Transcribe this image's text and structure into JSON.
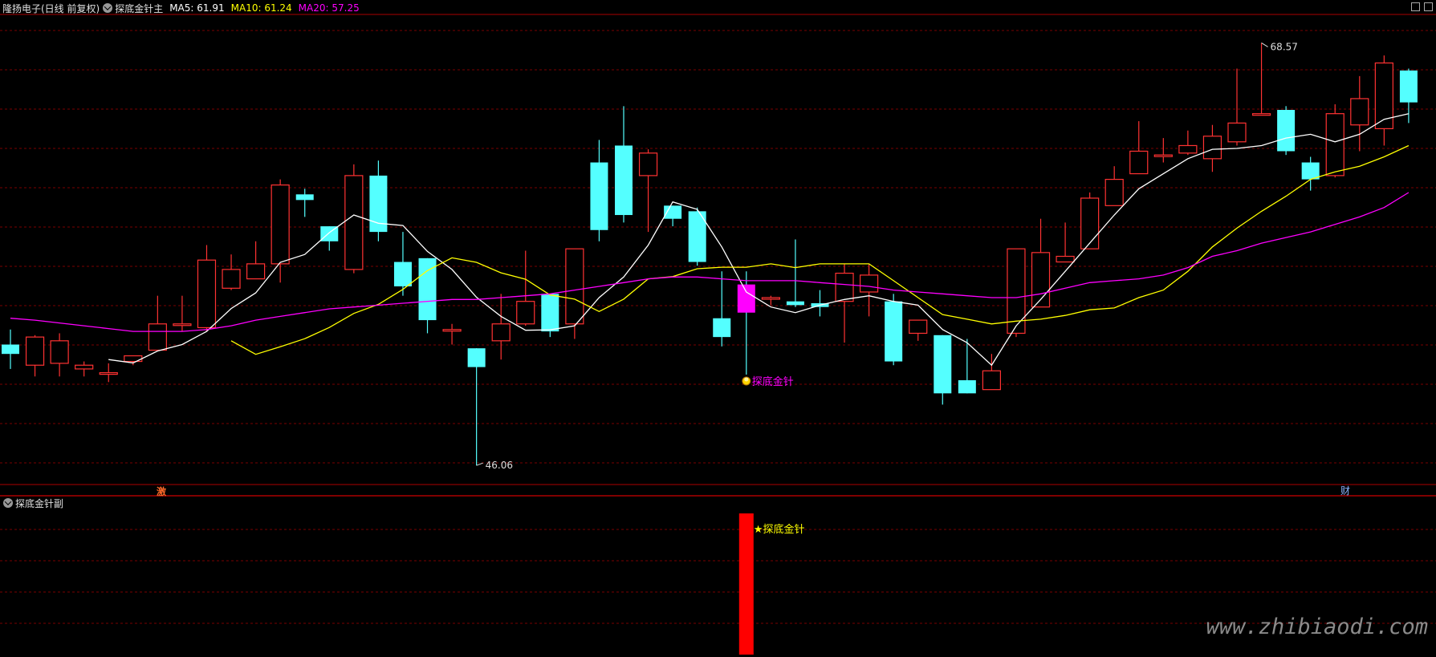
{
  "header": {
    "stock_name": "隆扬电子(日线 前复权)",
    "indicator_name": "探底金针主",
    "ma5_label": "MA5: 61.91",
    "ma10_label": "MA10: 61.24",
    "ma20_label": "MA20: 57.25"
  },
  "sub_panel": {
    "title": "探底金针副",
    "signal_label": "★探底金针"
  },
  "watermark": "www.zhibiaodi.com",
  "colors": {
    "up": "#ff3232",
    "down": "#54ffff",
    "ma5": "#ffffff",
    "ma10": "#ffff00",
    "ma20": "#ff00ff",
    "grid": "#7a0000",
    "signal": "#ff00ff",
    "bar": "#ff0000"
  },
  "icons": {
    "collapse": "chevron-circle-icon",
    "signal": "gold-coin-icon"
  },
  "chart_data": [
    {
      "type": "candlestick",
      "title": "探底金针主",
      "ylim": [
        45,
        70
      ],
      "grid": true,
      "annotations": {
        "high": "68.57",
        "low": "46.06",
        "signal": "探底金针",
        "markers": [
          "激",
          "财"
        ]
      },
      "candles": [
        [
          52.5,
          52.0,
          51.2,
          53.3
        ],
        [
          51.4,
          52.9,
          50.8,
          53.0
        ],
        [
          51.5,
          52.7,
          50.8,
          53.1
        ],
        [
          51.2,
          51.4,
          50.8,
          51.6
        ],
        [
          51.0,
          51.0,
          50.5,
          51.5
        ],
        [
          51.6,
          51.9,
          51.4,
          51.9
        ],
        [
          52.2,
          53.6,
          52.2,
          55.1
        ],
        [
          53.6,
          53.6,
          53.2,
          55.1
        ],
        [
          53.4,
          57.0,
          53.2,
          57.8
        ],
        [
          55.5,
          56.5,
          55.4,
          57.3
        ],
        [
          56.0,
          56.8,
          56.0,
          58.0
        ],
        [
          56.8,
          61.0,
          55.8,
          61.3
        ],
        [
          60.5,
          60.2,
          59.3,
          60.8
        ],
        [
          58.8,
          58.0,
          57.5,
          58.8
        ],
        [
          56.5,
          61.5,
          56.3,
          62.1
        ],
        [
          61.5,
          58.5,
          58.0,
          62.3
        ],
        [
          56.9,
          55.6,
          55.1,
          58.5
        ],
        [
          57.1,
          53.8,
          53.1,
          57.1
        ],
        [
          53.3,
          53.3,
          52.5,
          53.6
        ],
        [
          52.3,
          51.3,
          46.06,
          52.3
        ],
        [
          52.7,
          53.6,
          51.7,
          55.2
        ],
        [
          53.6,
          54.8,
          53.5,
          57.5
        ],
        [
          55.2,
          53.2,
          52.9,
          55.2
        ],
        [
          53.6,
          57.6,
          52.8,
          57.6
        ],
        [
          62.2,
          58.6,
          58.0,
          63.4
        ],
        [
          63.1,
          59.4,
          59.0,
          65.2
        ],
        [
          61.5,
          62.7,
          58.5,
          62.9
        ],
        [
          59.9,
          59.2,
          58.8,
          59.9
        ],
        [
          59.6,
          56.9,
          56.7,
          59.8
        ],
        [
          53.9,
          52.9,
          52.4,
          56.4
        ],
        [
          55.7,
          54.2,
          50.9,
          56.4
        ],
        [
          55.0,
          55.0,
          54.6,
          55.1
        ],
        [
          54.8,
          54.6,
          54.5,
          58.1
        ],
        [
          54.7,
          54.5,
          54.0,
          55.4
        ],
        [
          54.8,
          56.3,
          52.6,
          56.8
        ],
        [
          55.3,
          56.2,
          54.0,
          56.8
        ],
        [
          54.8,
          51.6,
          51.4,
          55.2
        ],
        [
          53.1,
          53.8,
          52.7,
          53.8
        ],
        [
          53.0,
          49.9,
          49.3,
          53.0
        ],
        [
          50.6,
          49.9,
          49.9,
          52.8
        ],
        [
          50.1,
          51.1,
          50.1,
          52.0
        ],
        [
          53.1,
          57.6,
          52.9,
          57.6
        ],
        [
          54.5,
          57.4,
          54.5,
          59.2
        ],
        [
          56.9,
          57.2,
          56.9,
          59.0
        ],
        [
          57.6,
          60.3,
          57.6,
          60.6
        ],
        [
          59.9,
          61.3,
          59.9,
          62.0
        ],
        [
          61.6,
          62.8,
          61.6,
          64.4
        ],
        [
          62.6,
          62.6,
          62.2,
          63.5
        ],
        [
          62.7,
          63.1,
          62.6,
          63.9
        ],
        [
          62.4,
          63.6,
          61.7,
          64.2
        ],
        [
          63.3,
          64.3,
          63.1,
          67.2
        ],
        [
          64.8,
          64.8,
          64.8,
          68.57
        ],
        [
          65.0,
          62.8,
          62.6,
          65.2
        ],
        [
          62.2,
          61.3,
          60.7,
          62.5
        ],
        [
          61.5,
          64.8,
          61.4,
          65.3
        ],
        [
          64.2,
          65.6,
          62.8,
          66.8
        ],
        [
          64.0,
          67.5,
          63.1,
          67.9
        ],
        [
          67.1,
          65.4,
          64.3,
          67.2
        ]
      ],
      "series": [
        {
          "name": "MA5",
          "values": [
            null,
            null,
            null,
            null,
            51.7,
            51.52,
            52.16,
            52.5,
            53.2,
            54.42,
            55.25,
            56.88,
            57.3,
            58.46,
            59.4,
            58.96,
            58.84,
            57.46,
            56.5,
            55.02,
            54.0,
            53.26,
            53.28,
            53.5,
            55.0,
            56.1,
            57.8,
            60.1,
            59.7,
            57.7,
            55.3,
            54.5,
            54.2,
            54.6,
            54.9,
            55.1,
            54.8,
            54.6,
            53.3,
            52.6,
            51.4,
            53.5,
            54.9,
            56.4,
            57.9,
            59.4,
            60.8,
            61.6,
            62.4,
            62.9,
            62.95,
            63.1,
            63.5,
            63.7,
            63.3,
            63.7,
            64.5,
            64.8
          ]
        },
        {
          "name": "MA10",
          "values": [
            null,
            null,
            null,
            null,
            null,
            null,
            null,
            null,
            null,
            52.7,
            51.98,
            52.38,
            52.81,
            53.41,
            54.16,
            54.64,
            55.44,
            56.44,
            57.12,
            56.88,
            56.32,
            55.98,
            55.14,
            54.92,
            54.26,
            54.92,
            56.0,
            56.12,
            56.54,
            56.62,
            56.62,
            56.8,
            56.6,
            56.8,
            56.8,
            56.8,
            55.9,
            55.0,
            54.1,
            53.85,
            53.6,
            53.75,
            53.85,
            54.05,
            54.35,
            54.45,
            55.0,
            55.4,
            56.4,
            57.7,
            58.7,
            59.6,
            60.4,
            61.3,
            61.7,
            62.0,
            62.5,
            63.1
          ]
        },
        {
          "name": "MA20",
          "values": [
            53.9,
            53.8,
            53.65,
            53.5,
            53.35,
            53.2,
            53.2,
            53.2,
            53.3,
            53.5,
            53.8,
            54.0,
            54.2,
            54.4,
            54.5,
            54.6,
            54.7,
            54.8,
            54.9,
            54.9,
            55.0,
            55.1,
            55.2,
            55.4,
            55.6,
            55.8,
            56.0,
            56.1,
            56.1,
            56.0,
            55.9,
            55.9,
            55.9,
            55.8,
            55.7,
            55.6,
            55.4,
            55.3,
            55.2,
            55.1,
            55.0,
            55.0,
            55.2,
            55.5,
            55.8,
            55.9,
            56.0,
            56.2,
            56.6,
            57.2,
            57.5,
            57.9,
            58.2,
            58.5,
            58.9,
            59.3,
            59.8,
            60.6
          ]
        }
      ],
      "signal_index": 30
    },
    {
      "type": "bar",
      "title": "探底金针副",
      "ylim": [
        0,
        1
      ],
      "values_at_index": {
        "30": 1
      },
      "label": "★探底金针"
    }
  ]
}
